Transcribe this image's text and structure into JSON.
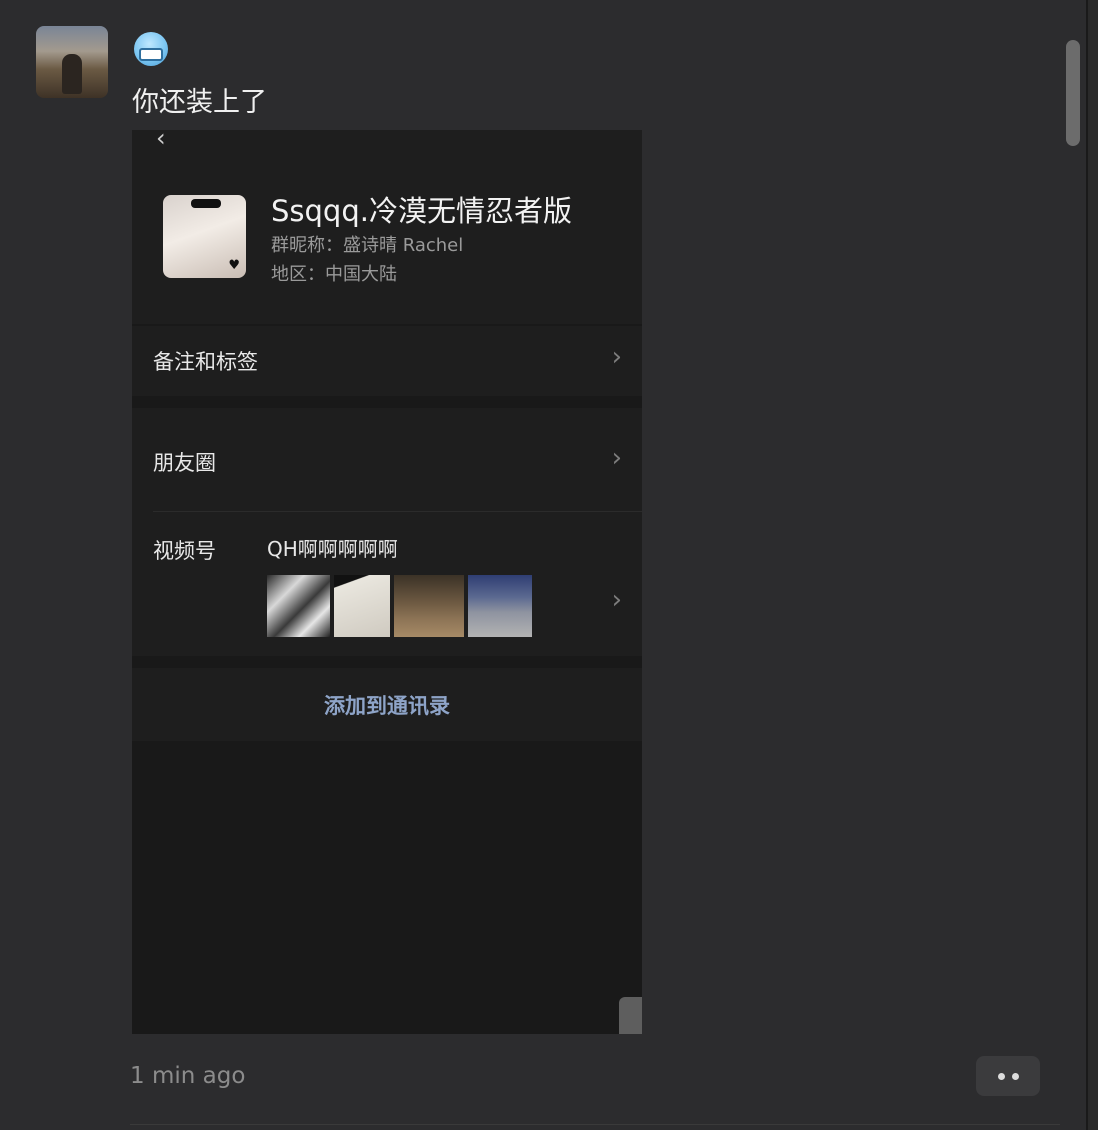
{
  "message": {
    "sender_avatar_icon": "avatar-mountain-person",
    "emoji_icon": "cold-face-emoji",
    "text": "你还装上了",
    "timestamp": "1 min ago"
  },
  "screenshot": {
    "profile": {
      "name": "Ssqqq.冷漠无情忍者版",
      "group_nickname": "群昵称：盛诗晴 Rachel",
      "region": "地区：中国大陆"
    },
    "rows": {
      "remarks_label": "备注和标签",
      "moments_label": "朋友圈",
      "channels_label": "视频号",
      "channel_name": "QH啊啊啊啊啊"
    },
    "add_button_label": "添加到通讯录"
  },
  "icons": {
    "back": "‹",
    "chevron": "›",
    "heart": "♥"
  },
  "colors": {
    "background": "#2c2c2e",
    "card": "#1e1e1e",
    "link": "#8ea4c8"
  }
}
